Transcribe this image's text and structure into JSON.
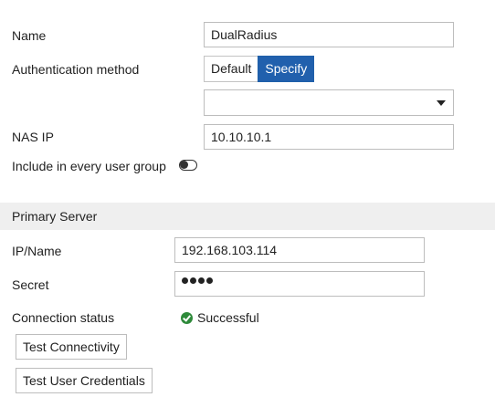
{
  "form": {
    "name_label": "Name",
    "name_value": "DualRadius",
    "auth_label": "Authentication method",
    "auth_options": [
      "Default",
      "Specify"
    ],
    "auth_selected": "Specify",
    "auth_select_value": "",
    "nas_ip_label": "NAS IP",
    "nas_ip_value": "10.10.10.1",
    "include_label": "Include in every user group",
    "include_enabled": false
  },
  "primary_server": {
    "section_title": "Primary Server",
    "ip_label": "IP/Name",
    "ip_value": "192.168.103.114",
    "secret_label": "Secret",
    "secret_masked_length": 4,
    "connection_label": "Connection status",
    "connection_status": "Successful",
    "connection_status_color": "#2e8a3a",
    "test_connectivity_label": "Test Connectivity",
    "test_credentials_label": "Test User Credentials"
  },
  "icons": {
    "status": "check-circle-icon",
    "dropdown": "chevron-down-icon",
    "toggle": "toggle-off-icon"
  },
  "colors": {
    "accent": "#2160ad",
    "section_bg": "#efefef",
    "border": "#bdbdbd"
  }
}
